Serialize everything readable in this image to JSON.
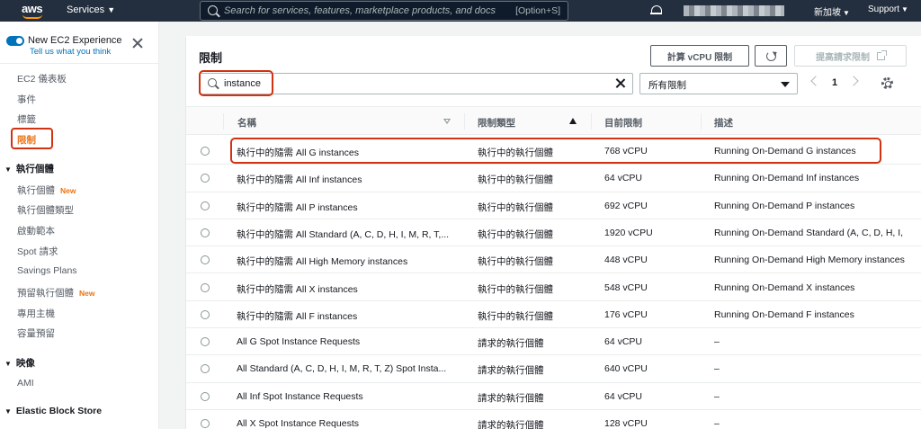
{
  "topnav": {
    "logo": "aws",
    "services_label": "Services",
    "search_placeholder": "Search for services, features, marketplace products, and docs",
    "search_shortcut": "[Option+S]",
    "region": "新加坡",
    "support": "Support"
  },
  "sidebar": {
    "experience_title": "New EC2 Experience",
    "experience_link": "Tell us what you think",
    "items": [
      {
        "label": "EC2 儀表板"
      },
      {
        "label": "事件"
      },
      {
        "label": "標籤"
      },
      {
        "label": "限制"
      }
    ],
    "sections": [
      {
        "label": "執行個體",
        "items": [
          {
            "label": "執行個體",
            "badge": "New"
          },
          {
            "label": "執行個體類型"
          },
          {
            "label": "啟動範本"
          },
          {
            "label": "Spot 請求"
          },
          {
            "label": "Savings Plans"
          },
          {
            "label": "預留執行個體",
            "badge": "New"
          },
          {
            "label": "專用主機"
          },
          {
            "label": "容量預留"
          }
        ]
      },
      {
        "label": "映像",
        "items": [
          {
            "label": "AMI"
          }
        ]
      },
      {
        "label": "Elastic Block Store",
        "items": []
      }
    ]
  },
  "main": {
    "title": "限制",
    "buttons": {
      "calc_vcpu": "計算 vCPU 限制",
      "increase": "提高請求限制"
    },
    "filter_value": "instance",
    "select_value": "所有限制",
    "page": "1",
    "columns": [
      "名稱",
      "限制類型",
      "目前限制",
      "描述"
    ],
    "rows": [
      {
        "name": "執行中的隨需 All G instances",
        "type": "執行中的執行個體",
        "limit": "768 vCPU",
        "desc": "Running On-Demand G instances"
      },
      {
        "name": "執行中的隨需 All Inf instances",
        "type": "執行中的執行個體",
        "limit": "64 vCPU",
        "desc": "Running On-Demand Inf instances"
      },
      {
        "name": "執行中的隨需 All P instances",
        "type": "執行中的執行個體",
        "limit": "692 vCPU",
        "desc": "Running On-Demand P instances"
      },
      {
        "name": "執行中的隨需 All Standard (A, C, D, H, I, M, R, T,...",
        "type": "執行中的執行個體",
        "limit": "1920 vCPU",
        "desc": "Running On-Demand Standard (A, C, D, H, I,"
      },
      {
        "name": "執行中的隨需 All High Memory instances",
        "type": "執行中的執行個體",
        "limit": "448 vCPU",
        "desc": "Running On-Demand High Memory instances"
      },
      {
        "name": "執行中的隨需 All X instances",
        "type": "執行中的執行個體",
        "limit": "548 vCPU",
        "desc": "Running On-Demand X instances"
      },
      {
        "name": "執行中的隨需 All F instances",
        "type": "執行中的執行個體",
        "limit": "176 vCPU",
        "desc": "Running On-Demand F instances"
      },
      {
        "name": "All G Spot Instance Requests",
        "type": "請求的執行個體",
        "limit": "64 vCPU",
        "desc": "–"
      },
      {
        "name": "All Standard (A, C, D, H, I, M, R, T, Z) Spot Insta...",
        "type": "請求的執行個體",
        "limit": "640 vCPU",
        "desc": "–"
      },
      {
        "name": "All Inf Spot Instance Requests",
        "type": "請求的執行個體",
        "limit": "64 vCPU",
        "desc": "–"
      },
      {
        "name": "All X Spot Instance Requests",
        "type": "請求的執行個體",
        "limit": "128 vCPU",
        "desc": "–"
      }
    ]
  }
}
